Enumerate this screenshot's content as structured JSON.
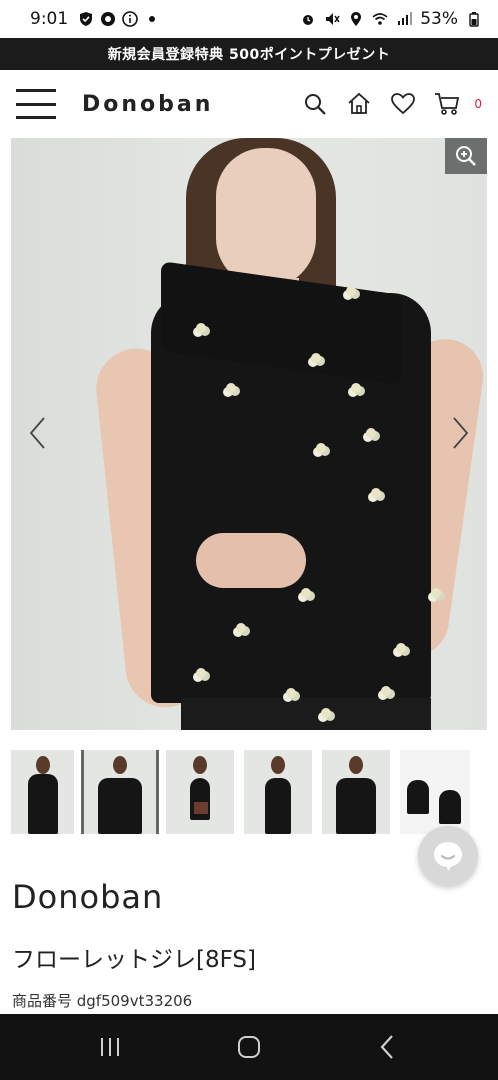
{
  "status_bar": {
    "time": "9:01",
    "battery": "53%"
  },
  "promo_banner": {
    "text": "新規会員登録特典 500ポイントプレゼント"
  },
  "header": {
    "logo": "Donoban",
    "cart_count": "0",
    "icons": [
      "menu-icon",
      "search-icon",
      "home-icon",
      "heart-icon",
      "cart-icon"
    ]
  },
  "gallery": {
    "thumbnail_count": 6,
    "active_index": 1,
    "icons": [
      "zoom-icon",
      "chevron-left-icon",
      "chevron-right-icon"
    ]
  },
  "product": {
    "brand": "Donoban",
    "name": "フローレットジレ[8FS]",
    "code": "商品番号 dgf509vt33206"
  },
  "colors": {
    "promo_bg": "#1b1b1b",
    "cart_badge": "#dd2233",
    "nav_bar_bg": "#121212"
  }
}
